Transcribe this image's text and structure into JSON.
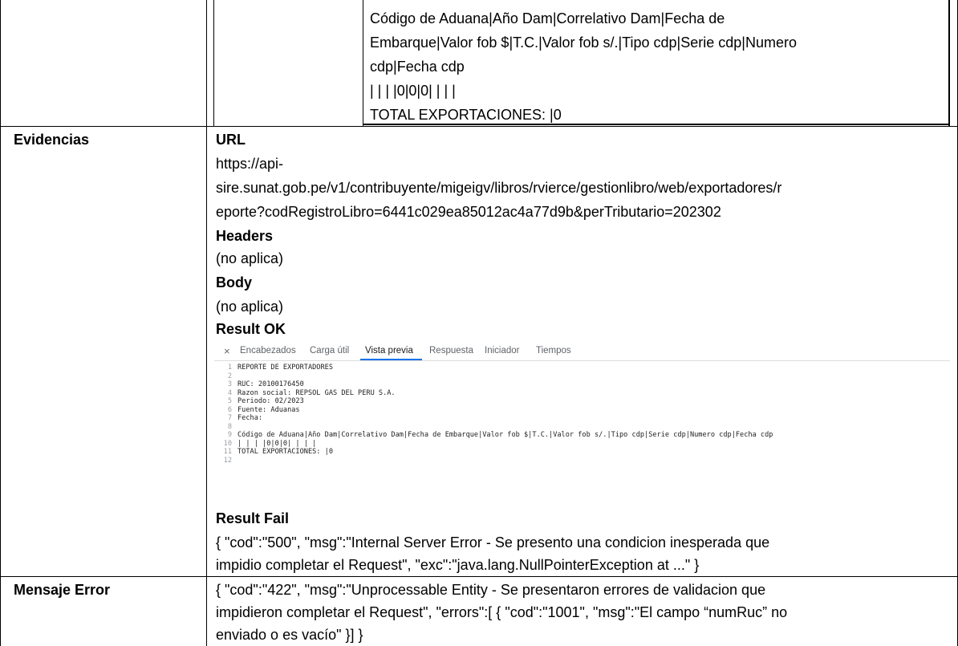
{
  "top_cell": {
    "lines": [
      "Código de Aduana|Año Dam|Correlativo Dam|Fecha de",
      "Embarque|Valor fob $|T.C.|Valor fob s/.|Tipo cdp|Serie cdp|Numero",
      "cdp|Fecha cdp",
      " | | | |0|0|0| | | |",
      "TOTAL EXPORTACIONES: |0"
    ]
  },
  "evidencias": {
    "label": "Evidencias",
    "url_heading": "URL",
    "url_lines": [
      "https://api-",
      "sire.sunat.gob.pe/v1/contribuyente/migeigv/libros/rvierce/gestionlibro/web/exportadores/r",
      "eporte?codRegistroLibro=6441c029ea85012ac4a77d9b&perTributario=202302"
    ],
    "headers_heading": "Headers",
    "headers_value": "(no aplica)",
    "body_heading": "Body",
    "body_value": "(no aplica)",
    "result_ok_heading": "Result OK",
    "screenshot": {
      "close_glyph": "×",
      "tabs": [
        "Encabezados",
        "Carga útil",
        "Vista previa",
        "Respuesta",
        "Iniciador",
        "Tiempos"
      ],
      "active_tab": "Vista previa",
      "code_lines": [
        {
          "n": "1",
          "t": "REPORTE DE EXPORTADORES"
        },
        {
          "n": "2",
          "t": ""
        },
        {
          "n": "3",
          "t": "RUC: 20100176450"
        },
        {
          "n": "4",
          "t": "Razon social: REPSOL GAS DEL PERU S.A."
        },
        {
          "n": "5",
          "t": "Periodo: 02/2023"
        },
        {
          "n": "6",
          "t": "Fuente: Aduanas"
        },
        {
          "n": "7",
          "t": "Fecha:"
        },
        {
          "n": "8",
          "t": ""
        },
        {
          "n": "9",
          "t": "Código de Aduana|Año Dam|Correlativo Dam|Fecha de Embarque|Valor fob $|T.C.|Valor fob s/.|Tipo cdp|Serie cdp|Numero cdp|Fecha cdp"
        },
        {
          "n": "10",
          "t": " | | | |0|0|0| | | |"
        },
        {
          "n": "11",
          "t": "TOTAL EXPORTACIONES: |0"
        },
        {
          "n": "12",
          "t": ""
        }
      ]
    },
    "result_fail_heading": "Result Fail",
    "result_fail_lines": [
      "{ \"cod\":\"500\", \"msg\":\"Internal Server Error - Se presento una condicion inesperada que",
      "impidio completar el Request\", \"exc\":\"java.lang.NullPointerException at ...\" }"
    ]
  },
  "mensaje_error": {
    "label": "Mensaje Error",
    "lines": [
      "{ \"cod\":\"422\", \"msg\":\"Unprocessable Entity - Se presentaron errores de validacion que",
      "impidieron completar el Request\", \"errors\":[ { \"cod\":\"1001\", \"msg\":\"El campo “numRuc” no",
      "enviado o es vacío\" }] }"
    ]
  }
}
